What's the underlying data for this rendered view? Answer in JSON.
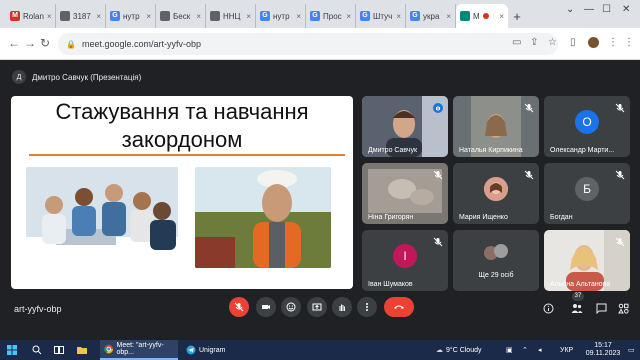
{
  "browser": {
    "tabs": [
      {
        "label": "Rolan",
        "favicon_color": "#d93025",
        "favicon": "M"
      },
      {
        "label": "3187",
        "favicon_color": "#5f6368",
        "favicon": ""
      },
      {
        "label": "нутр",
        "favicon_color": "#4285f4",
        "favicon": "G"
      },
      {
        "label": "Беск",
        "favicon_color": "#5f6368",
        "favicon": ""
      },
      {
        "label": "ННЦ",
        "favicon_color": "#5f6368",
        "favicon": ""
      },
      {
        "label": "нутр",
        "favicon_color": "#4285f4",
        "favicon": "G"
      },
      {
        "label": "Прос",
        "favicon_color": "#4285f4",
        "favicon": "G"
      },
      {
        "label": "Штуч",
        "favicon_color": "#4285f4",
        "favicon": "G"
      },
      {
        "label": "укра",
        "favicon_color": "#4285f4",
        "favicon": "G"
      },
      {
        "label": "M",
        "favicon_color": "#00897b",
        "favicon": "",
        "active": true
      }
    ],
    "new_tab": "+",
    "url": "meet.google.com/art-yyfv-obp"
  },
  "meet": {
    "presenter_initial": "Д",
    "presenter_label": "Дмитро Савчук (Презентація)",
    "slide_title_line1": "Стажування та навчання",
    "slide_title_line2": "закордоном",
    "tiles": [
      {
        "name": "Дмитро Савчук",
        "type": "video"
      },
      {
        "name": "Наталья Кирпикина",
        "type": "video"
      },
      {
        "name": "Олександр Марти...",
        "type": "avatar",
        "initial": "О",
        "color": "#1a73e8"
      },
      {
        "name": "Ніна Григорян",
        "type": "video"
      },
      {
        "name": "Мария Ищенко",
        "type": "photo"
      },
      {
        "name": "Богдан",
        "type": "avatar",
        "initial": "Б",
        "color": "#5f6368"
      },
      {
        "name": "Іван Шумаков",
        "type": "avatar",
        "initial": "І",
        "color": "#c2185b"
      },
      {
        "name": "Ще 29 осіб",
        "type": "more"
      },
      {
        "name": "Альона Альтанова",
        "type": "video"
      }
    ],
    "meeting_code": "art-yyfv-obp",
    "participants_count": "37"
  },
  "taskbar": {
    "chrome_label": "Meet: \"art-yyfv-obp...",
    "unigram_label": "Unigram",
    "weather": "9°C  Cloudy",
    "lang": "УКР",
    "time": "15:17",
    "date": "09.11.2023"
  }
}
